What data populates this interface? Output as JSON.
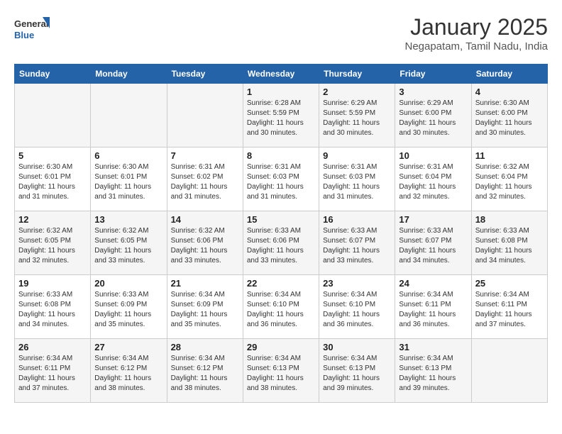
{
  "logo": {
    "line1": "General",
    "line2": "Blue"
  },
  "title": "January 2025",
  "subtitle": "Negapatam, Tamil Nadu, India",
  "weekdays": [
    "Sunday",
    "Monday",
    "Tuesday",
    "Wednesday",
    "Thursday",
    "Friday",
    "Saturday"
  ],
  "weeks": [
    [
      {
        "day": "",
        "info": ""
      },
      {
        "day": "",
        "info": ""
      },
      {
        "day": "",
        "info": ""
      },
      {
        "day": "1",
        "info": "Sunrise: 6:28 AM\nSunset: 5:59 PM\nDaylight: 11 hours\nand 30 minutes."
      },
      {
        "day": "2",
        "info": "Sunrise: 6:29 AM\nSunset: 5:59 PM\nDaylight: 11 hours\nand 30 minutes."
      },
      {
        "day": "3",
        "info": "Sunrise: 6:29 AM\nSunset: 6:00 PM\nDaylight: 11 hours\nand 30 minutes."
      },
      {
        "day": "4",
        "info": "Sunrise: 6:30 AM\nSunset: 6:00 PM\nDaylight: 11 hours\nand 30 minutes."
      }
    ],
    [
      {
        "day": "5",
        "info": "Sunrise: 6:30 AM\nSunset: 6:01 PM\nDaylight: 11 hours\nand 31 minutes."
      },
      {
        "day": "6",
        "info": "Sunrise: 6:30 AM\nSunset: 6:01 PM\nDaylight: 11 hours\nand 31 minutes."
      },
      {
        "day": "7",
        "info": "Sunrise: 6:31 AM\nSunset: 6:02 PM\nDaylight: 11 hours\nand 31 minutes."
      },
      {
        "day": "8",
        "info": "Sunrise: 6:31 AM\nSunset: 6:03 PM\nDaylight: 11 hours\nand 31 minutes."
      },
      {
        "day": "9",
        "info": "Sunrise: 6:31 AM\nSunset: 6:03 PM\nDaylight: 11 hours\nand 31 minutes."
      },
      {
        "day": "10",
        "info": "Sunrise: 6:31 AM\nSunset: 6:04 PM\nDaylight: 11 hours\nand 32 minutes."
      },
      {
        "day": "11",
        "info": "Sunrise: 6:32 AM\nSunset: 6:04 PM\nDaylight: 11 hours\nand 32 minutes."
      }
    ],
    [
      {
        "day": "12",
        "info": "Sunrise: 6:32 AM\nSunset: 6:05 PM\nDaylight: 11 hours\nand 32 minutes."
      },
      {
        "day": "13",
        "info": "Sunrise: 6:32 AM\nSunset: 6:05 PM\nDaylight: 11 hours\nand 33 minutes."
      },
      {
        "day": "14",
        "info": "Sunrise: 6:32 AM\nSunset: 6:06 PM\nDaylight: 11 hours\nand 33 minutes."
      },
      {
        "day": "15",
        "info": "Sunrise: 6:33 AM\nSunset: 6:06 PM\nDaylight: 11 hours\nand 33 minutes."
      },
      {
        "day": "16",
        "info": "Sunrise: 6:33 AM\nSunset: 6:07 PM\nDaylight: 11 hours\nand 33 minutes."
      },
      {
        "day": "17",
        "info": "Sunrise: 6:33 AM\nSunset: 6:07 PM\nDaylight: 11 hours\nand 34 minutes."
      },
      {
        "day": "18",
        "info": "Sunrise: 6:33 AM\nSunset: 6:08 PM\nDaylight: 11 hours\nand 34 minutes."
      }
    ],
    [
      {
        "day": "19",
        "info": "Sunrise: 6:33 AM\nSunset: 6:08 PM\nDaylight: 11 hours\nand 34 minutes."
      },
      {
        "day": "20",
        "info": "Sunrise: 6:33 AM\nSunset: 6:09 PM\nDaylight: 11 hours\nand 35 minutes."
      },
      {
        "day": "21",
        "info": "Sunrise: 6:34 AM\nSunset: 6:09 PM\nDaylight: 11 hours\nand 35 minutes."
      },
      {
        "day": "22",
        "info": "Sunrise: 6:34 AM\nSunset: 6:10 PM\nDaylight: 11 hours\nand 36 minutes."
      },
      {
        "day": "23",
        "info": "Sunrise: 6:34 AM\nSunset: 6:10 PM\nDaylight: 11 hours\nand 36 minutes."
      },
      {
        "day": "24",
        "info": "Sunrise: 6:34 AM\nSunset: 6:11 PM\nDaylight: 11 hours\nand 36 minutes."
      },
      {
        "day": "25",
        "info": "Sunrise: 6:34 AM\nSunset: 6:11 PM\nDaylight: 11 hours\nand 37 minutes."
      }
    ],
    [
      {
        "day": "26",
        "info": "Sunrise: 6:34 AM\nSunset: 6:11 PM\nDaylight: 11 hours\nand 37 minutes."
      },
      {
        "day": "27",
        "info": "Sunrise: 6:34 AM\nSunset: 6:12 PM\nDaylight: 11 hours\nand 38 minutes."
      },
      {
        "day": "28",
        "info": "Sunrise: 6:34 AM\nSunset: 6:12 PM\nDaylight: 11 hours\nand 38 minutes."
      },
      {
        "day": "29",
        "info": "Sunrise: 6:34 AM\nSunset: 6:13 PM\nDaylight: 11 hours\nand 38 minutes."
      },
      {
        "day": "30",
        "info": "Sunrise: 6:34 AM\nSunset: 6:13 PM\nDaylight: 11 hours\nand 39 minutes."
      },
      {
        "day": "31",
        "info": "Sunrise: 6:34 AM\nSunset: 6:13 PM\nDaylight: 11 hours\nand 39 minutes."
      },
      {
        "day": "",
        "info": ""
      }
    ]
  ]
}
